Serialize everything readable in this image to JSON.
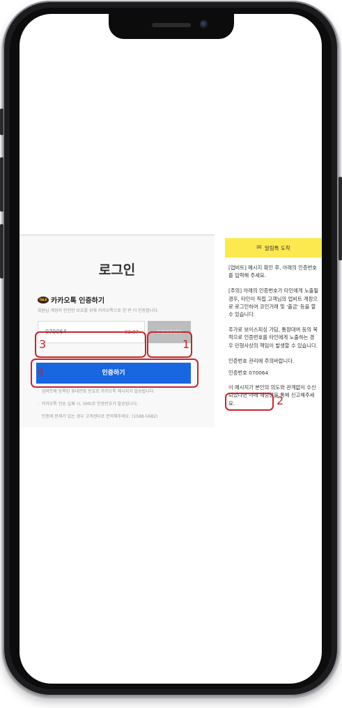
{
  "login": {
    "title": "로그인",
    "kakao_icon": "TALK",
    "kakao_heading": "카카오톡 인증하기",
    "kakao_sub": "회원님 계정의 안전한 보호를 위해 카카오톡으로 한 번 더 인증합니다.",
    "code_input_value": "070064",
    "timer": "02:07",
    "resend_button": "인증번호받기",
    "verify_button": "인증하기",
    "notes": [
      "업비트에 등록된 휴대전화 번호로 카카오톡 메시지가 발송됩니다.",
      "카카오톡 전송 실패 시, SMS로 인증번호가 발송됩니다.",
      "인증에 문제가 있는 경우 고객센터로 문의해주세요. (1588-5682)"
    ]
  },
  "alimtalk": {
    "header": "알림톡 도착",
    "header_icon": "envelope-icon",
    "paragraphs": [
      "[업비트] 메시지 확인 후, 아래의 인증번호를 입력해 주세요.",
      "[주의] 아래의 인증번호가 타인에게 노출될 경우, 타인이 직접 고객님의 업비트 계정으로 로그인하여 코인거래 및 '출금' 등을 할 수 있습니다.",
      "추가로 보이스피싱 가담, 통장대여 등의 목적으로 인증번호를 타인에게 노출하는 경우 민형사상의 책임이 발생할 수 있습니다.",
      "인증번호 관리에 주의바랍니다."
    ],
    "code_line": "인증번호 070064",
    "footer": "이 메시지가 본인의 의도와 관계없이 수신되었다면 아래 채팅창을 통해 신고해주세요."
  },
  "annotations": {
    "n1": "1",
    "n2": "2",
    "n3": "3",
    "n4": "4",
    "color": "#c8232c"
  },
  "colors": {
    "primary_button": "#1866e0",
    "alim_header": "#fce94f",
    "timer": "#e23b3b"
  }
}
